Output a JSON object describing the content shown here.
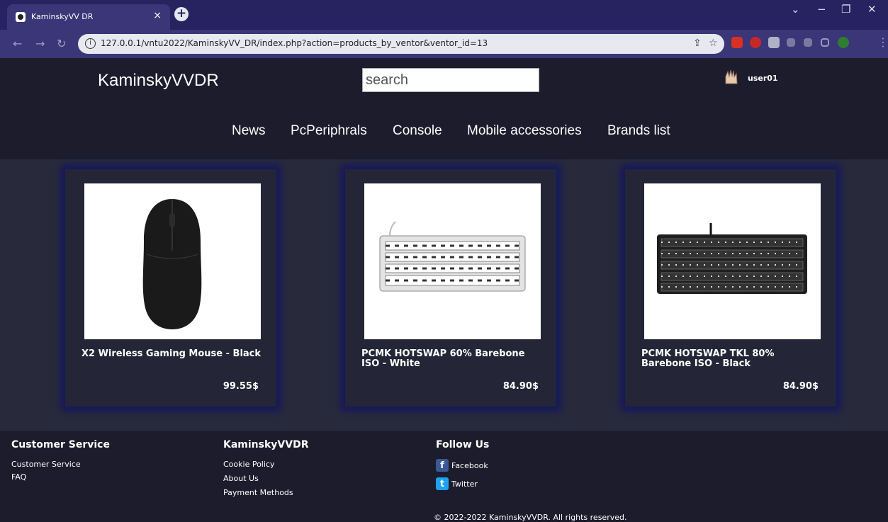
{
  "browser": {
    "tab_title": "KaminskyVV DR",
    "tab_close": "×",
    "new_tab": "+",
    "url": "127.0.0.1/vntu2022/KaminskyVV_DR/index.php?action=products_by_ventor&ventor_id=13",
    "window_controls": [
      "⌄",
      "−",
      "❐",
      "✕"
    ]
  },
  "header": {
    "brand": "KaminskyVVDR",
    "search_placeholder": "search",
    "username": "user01"
  },
  "nav": {
    "items": [
      "News",
      "PcPeriphrals",
      "Console",
      "Mobile accessories",
      "Brands list"
    ]
  },
  "products": [
    {
      "title": "X2 Wireless Gaming Mouse - Black",
      "price": "99.55$",
      "image": "mouse"
    },
    {
      "title": "PCMK HOTSWAP 60% Barebone ISO - White",
      "price": "84.90$",
      "image": "keyboard-white"
    },
    {
      "title": "PCMK HOTSWAP TKL 80% Barebone ISO - Black",
      "price": "84.90$",
      "image": "keyboard-black"
    }
  ],
  "footer": {
    "customer_service": {
      "heading": "Customer Service",
      "links": [
        "Customer Service",
        "FAQ"
      ]
    },
    "company": {
      "heading": "KaminskyVVDR",
      "links": [
        "Cookie Policy",
        "About Us",
        "Payment Methods"
      ]
    },
    "follow": {
      "heading": "Follow Us",
      "facebook": "Facebook",
      "twitter": "Twitter"
    },
    "copyright": "© 2022-2022 KaminskyVVDR. All rights reserved."
  },
  "colors": {
    "tab_bar": "#272361",
    "toolbar": "#3a3677",
    "page_bg": "#1c1c2c",
    "card_glow": "#141660",
    "facebook": "#3b5998",
    "twitter": "#1da1f2"
  }
}
